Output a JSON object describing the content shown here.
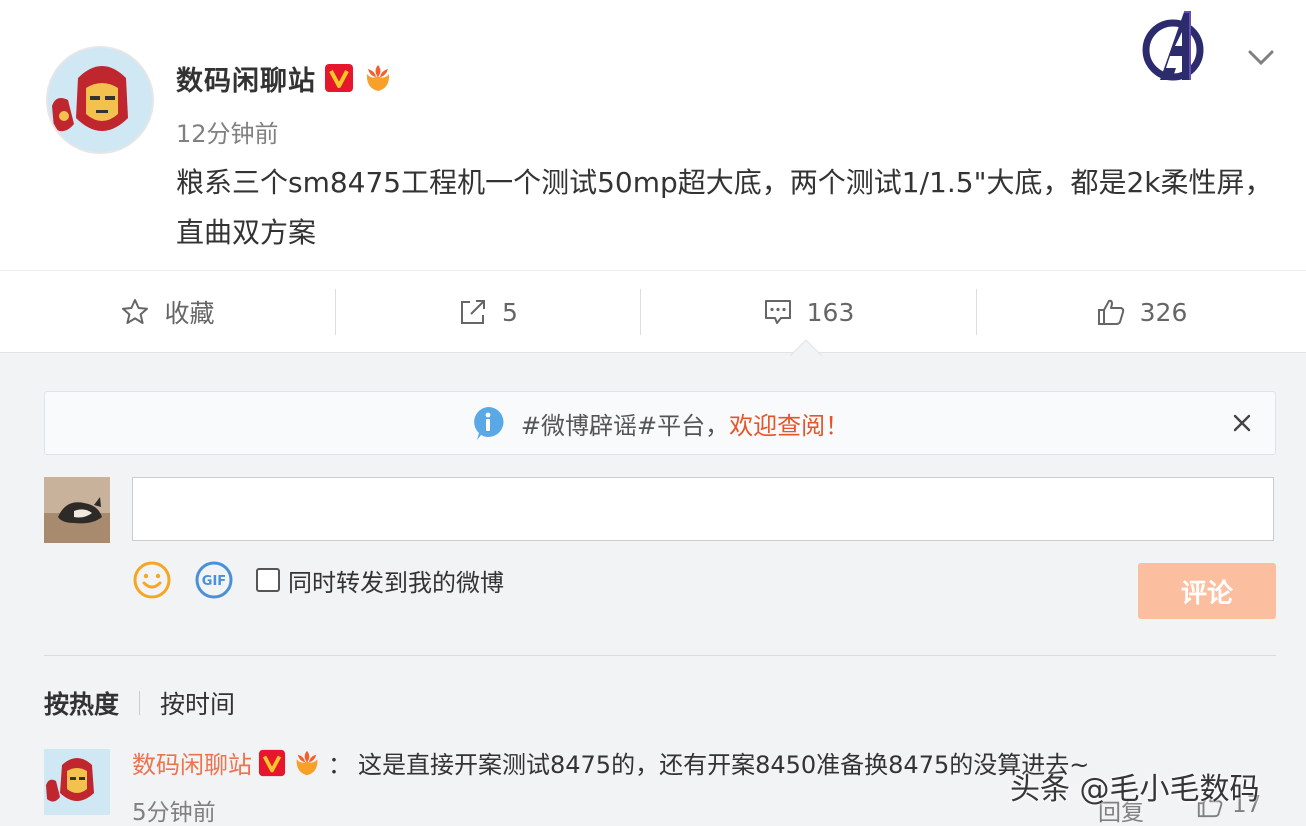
{
  "post": {
    "author": "数码闲聊站",
    "time": "12分钟前",
    "text": "粮系三个sm8475工程机一个测试50mp超大底，两个测试1/1.5\"大底，都是2k柔性屏，直曲双方案"
  },
  "actions": {
    "favorite_label": "收藏",
    "repost_count": "5",
    "comment_count": "163",
    "like_count": "326"
  },
  "notice": {
    "text": "#微博辟谣#平台，",
    "link": "欢迎查阅！"
  },
  "composer": {
    "input_value": "",
    "forward_label": "同时转发到我的微博",
    "submit_label": "评论"
  },
  "sort": {
    "hot_label": "按热度",
    "time_label": "按时间"
  },
  "comment": {
    "author": "数码闲聊站",
    "separator": "：",
    "text": "这是直接开案测试8475的，还有开案8450准备换8475的没算进去~",
    "time": "5分钟前",
    "reply_label": "回复",
    "like_count": "17"
  },
  "watermark": "头条 @毛小毛数码",
  "colors": {
    "accent": "#eb7350",
    "notice_link": "#e5542b",
    "submit_bg": "#fbbe9e",
    "verified": "#e6162d"
  },
  "icons": [
    "star-icon",
    "repost-icon",
    "comment-icon",
    "like-icon",
    "info-icon",
    "close-icon",
    "emoji-icon",
    "gif-icon",
    "chevron-down-icon",
    "avengers-logo-icon",
    "verified-badge-icon",
    "flower-badge-icon"
  ]
}
